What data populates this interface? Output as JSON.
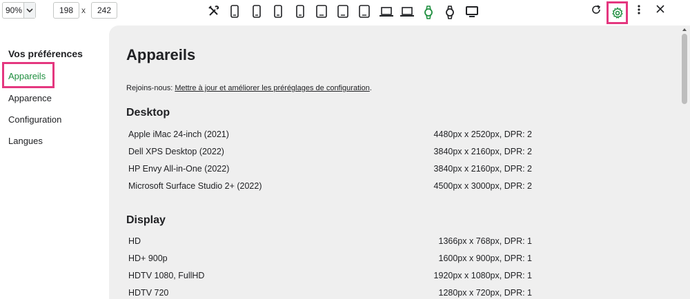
{
  "toolbar": {
    "zoom": "90%",
    "width": "198",
    "height": "242",
    "separator": "x",
    "devices": [
      "tools-icon",
      "phone-icon",
      "phone-icon",
      "phone-icon",
      "phone-icon",
      "tablet-icon",
      "tablet-icon",
      "tablet-icon",
      "laptop-icon",
      "laptop-icon",
      "watch-icon",
      "watch-icon",
      "monitor-icon"
    ],
    "active_device_index": 10,
    "accent_color": "#1e8e3e",
    "highlight_color": "#e4377f"
  },
  "sidebar": {
    "title": "Vos préférences",
    "items": [
      {
        "label": "Appareils",
        "active": true
      },
      {
        "label": "Apparence",
        "active": false
      },
      {
        "label": "Configuration",
        "active": false
      },
      {
        "label": "Langues",
        "active": false
      }
    ]
  },
  "main": {
    "title": "Appareils",
    "join_prefix": "Rejoins-nous: ",
    "join_link": "Mettre à jour et améliorer les préréglages de configuration",
    "join_suffix": ".",
    "sections": [
      {
        "title": "Desktop",
        "devices": [
          {
            "name": "Apple iMac 24-inch (2021)",
            "spec": "4480px x 2520px, DPR: 2"
          },
          {
            "name": "Dell XPS Desktop (2022)",
            "spec": "3840px x 2160px, DPR: 2"
          },
          {
            "name": "HP Envy All-in-One (2022)",
            "spec": "3840px x 2160px, DPR: 2"
          },
          {
            "name": "Microsoft Surface Studio 2+ (2022)",
            "spec": "4500px x 3000px, DPR: 2"
          }
        ]
      },
      {
        "title": "Display",
        "devices": [
          {
            "name": "HD",
            "spec": "1366px x 768px, DPR: 1"
          },
          {
            "name": "HD+ 900p",
            "spec": "1600px x 900px, DPR: 1"
          },
          {
            "name": "HDTV 1080, FullHD",
            "spec": "1920px x 1080px, DPR: 1"
          },
          {
            "name": "HDTV 720",
            "spec": "1280px x 720px, DPR: 1"
          }
        ]
      }
    ]
  }
}
